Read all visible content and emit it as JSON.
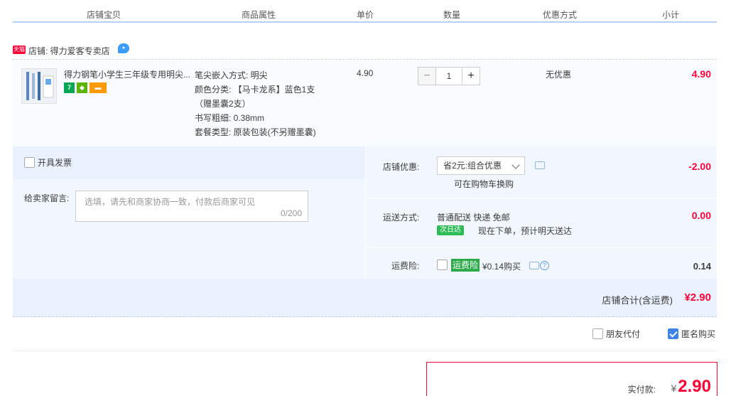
{
  "header": {
    "col_item": "店铺宝贝",
    "col_props": "商品属性",
    "col_price": "单价",
    "col_qty": "数量",
    "col_promo": "优惠方式",
    "col_subtotal": "小计"
  },
  "shop": {
    "badge": "天猫",
    "name": "店铺: 得力爱客专卖店"
  },
  "item": {
    "title": "得力钢笔小学生三年级专用明尖...",
    "props": [
      "笔尖嵌入方式: 明尖",
      "颜色分类: 【马卡龙系】蓝色1支",
      "（赠墨囊2支）",
      "书写粗细: 0.38mm",
      "套餐类型: 原装包装(不另赠墨囊)"
    ],
    "price": "4.90",
    "qty": "1",
    "qty_minus": "−",
    "qty_plus": "+",
    "promo": "无优惠",
    "subtotal": "4.90",
    "tag_seven": "7"
  },
  "invoice": {
    "label": "开具发票"
  },
  "message": {
    "label": "给卖家留言:",
    "placeholder": "选填，请先和商家协商一致，付款后商家可见",
    "count": "0/200"
  },
  "shop_discount": {
    "label": "店铺优惠:",
    "selected": "省2元:组合优惠",
    "note": "可在购物车换购",
    "amount": "-2.00"
  },
  "shipping": {
    "label": "运送方式:",
    "method": "普通配送 快递 免邮",
    "badge": "次日达",
    "eta": "现在下单，预计明天送达",
    "amount": "0.00"
  },
  "insurance": {
    "label": "运费险:",
    "tag": "运费险",
    "price": "¥0.14购买",
    "amount": "0.14",
    "help": "?"
  },
  "shop_total": {
    "label": "店铺合计(含运费)",
    "value": "¥2.90"
  },
  "options": {
    "friend_pay": "朋友代付",
    "anonymous": "匿名购买"
  },
  "payment": {
    "label": "实付款:",
    "currency": "¥",
    "value": "2.90"
  },
  "colors": {
    "accent_red": "#ff0036",
    "panel_blue": "#eaf2ff",
    "check_blue": "#3d84e6"
  }
}
